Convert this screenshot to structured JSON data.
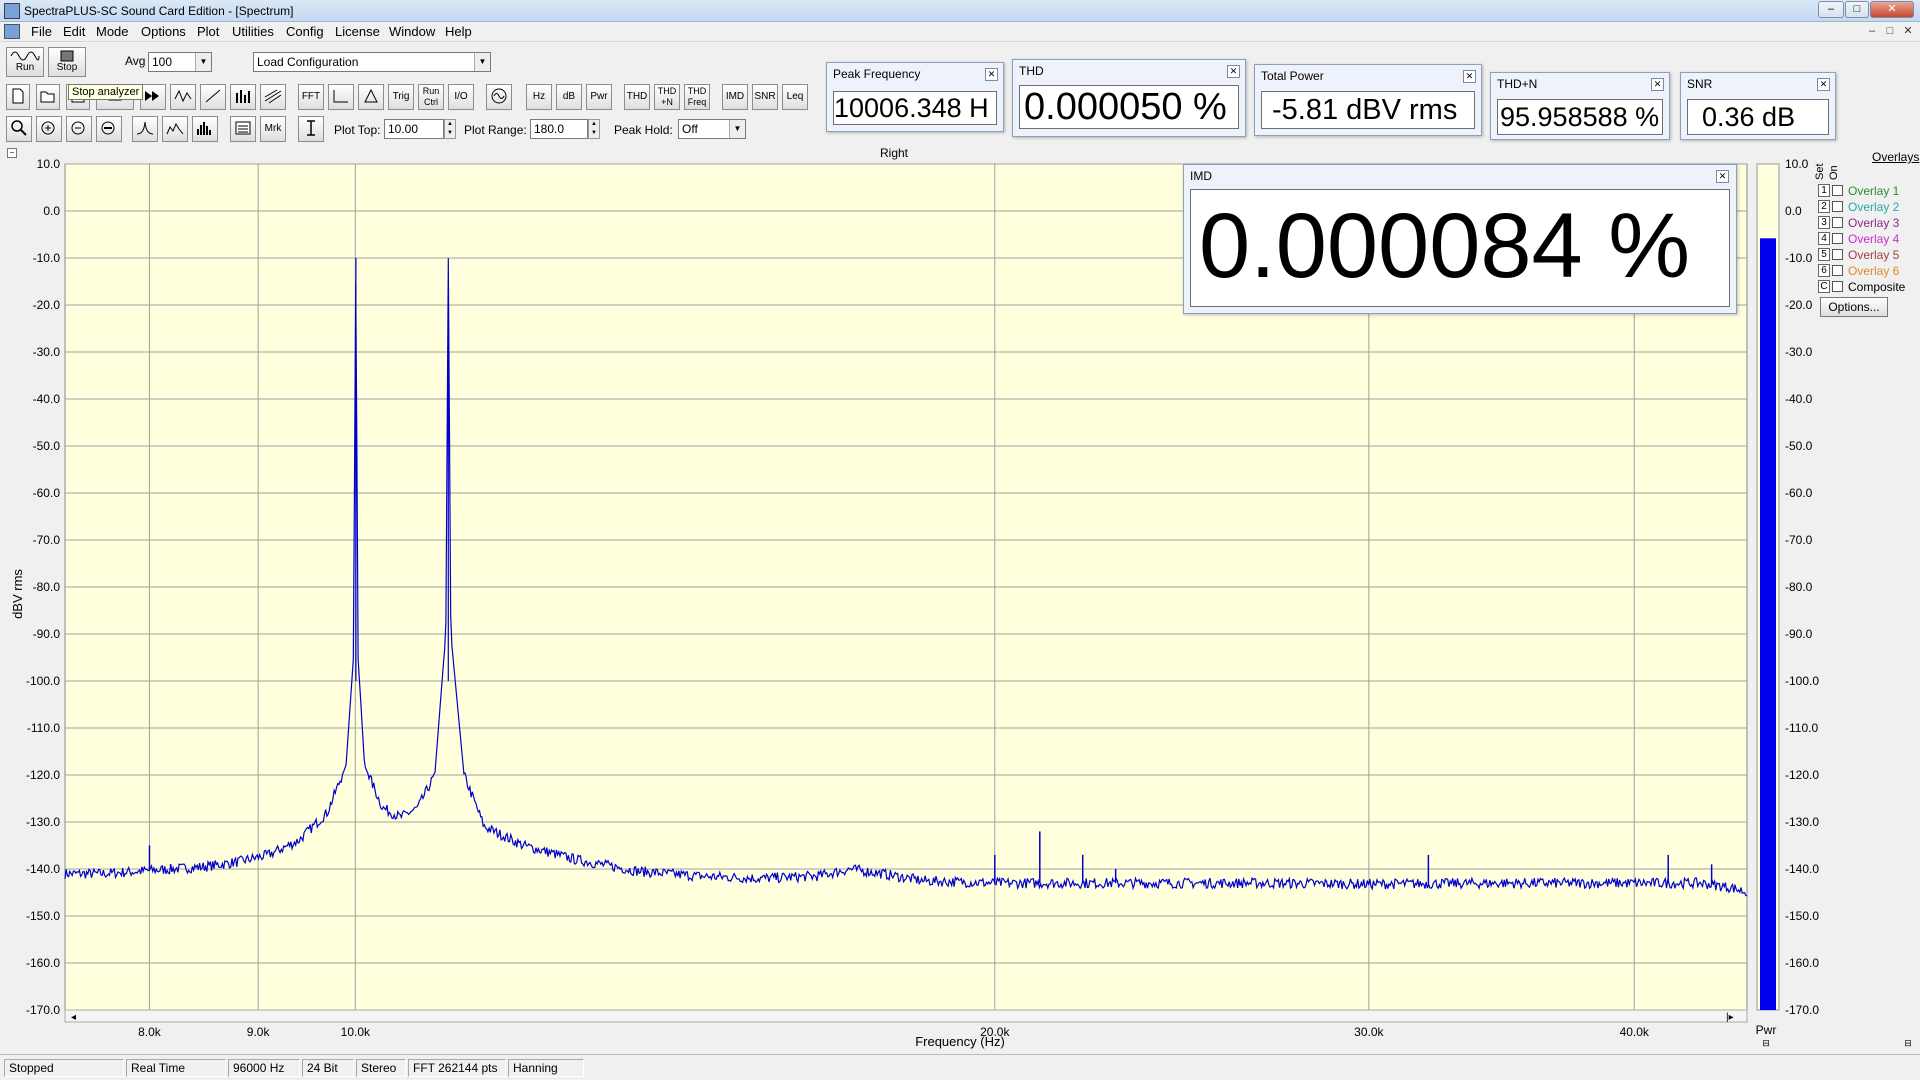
{
  "window": {
    "title": "SpectraPLUS-SC Sound Card Edition - [Spectrum]",
    "min": "–",
    "max": "□",
    "close": "✕"
  },
  "menu": [
    "File",
    "Edit",
    "Mode",
    "Options",
    "Plot",
    "Utilities",
    "Config",
    "License",
    "Window",
    "Help"
  ],
  "toolbar": {
    "run_label": "Run",
    "stop_label": "Stop",
    "avg_label": "Avg",
    "avg_value": "100",
    "load_config": "Load Configuration",
    "tooltip": "Stop analyzer",
    "fft": "FFT",
    "trig": "Trig",
    "run_ctrl": "Run Ctrl",
    "io": "I/O",
    "hz": "Hz",
    "db": "dB",
    "pwr": "Pwr",
    "thd": "THD",
    "thdn": "THD +N",
    "thd_freq": "THD Freq",
    "imd": "IMD",
    "snr": "SNR",
    "leq": "Leq",
    "mrk": "Mrk",
    "plot_top_label": "Plot Top:",
    "plot_top_value": "10.00",
    "plot_range_label": "Plot Range:",
    "plot_range_value": "180.0",
    "peak_hold_label": "Peak Hold:",
    "peak_hold_value": "Off"
  },
  "meters": {
    "peak_frequency": {
      "title": "Peak Frequency",
      "value": "10006.348 H"
    },
    "thd": {
      "title": "THD",
      "value": "0.000050  %"
    },
    "total_power": {
      "title": "Total Power",
      "value": "-5.81 dBV rms"
    },
    "thdn": {
      "title": "THD+N",
      "value": "95.958588 %"
    },
    "snr": {
      "title": "SNR",
      "value": "0.36 dB"
    },
    "imd": {
      "title": "IMD",
      "value": "0.000084  %"
    }
  },
  "chart_data": {
    "type": "line",
    "title": "Right",
    "xlabel": "Frequency (Hz)",
    "ylabel": "dBV rms",
    "xlim": [
      7300,
      45200
    ],
    "ylim": [
      -170,
      10
    ],
    "x_scale": "log",
    "y_ticks": [
      "10.0",
      "0.0",
      "-10.0",
      "-20.0",
      "-30.0",
      "-40.0",
      "-50.0",
      "-60.0",
      "-70.0",
      "-80.0",
      "-90.0",
      "-100.0",
      "-110.0",
      "-120.0",
      "-130.0",
      "-140.0",
      "-150.0",
      "-160.0",
      "-170.0"
    ],
    "x_ticks": [
      {
        "value": 8000,
        "label": "8.0k"
      },
      {
        "value": 9000,
        "label": "9.0k"
      },
      {
        "value": 10000,
        "label": "10.0k"
      },
      {
        "value": 20000,
        "label": "20.0k"
      },
      {
        "value": 30000,
        "label": "30.0k"
      },
      {
        "value": 40000,
        "label": "40.0k"
      }
    ],
    "grid": true,
    "series": [
      {
        "color": "#0000cc",
        "points": [
          [
            7300,
            -141
          ],
          [
            7600,
            -141
          ],
          [
            7900,
            -140.5
          ],
          [
            8200,
            -140
          ],
          [
            8500,
            -139.5
          ],
          [
            8800,
            -138.5
          ],
          [
            9100,
            -137
          ],
          [
            9400,
            -134
          ],
          [
            9700,
            -128
          ],
          [
            9900,
            -118
          ],
          [
            9980,
            -95
          ],
          [
            10006,
            -10
          ],
          [
            10030,
            -95
          ],
          [
            10100,
            -118
          ],
          [
            10300,
            -127
          ],
          [
            10500,
            -129
          ],
          [
            10700,
            -127
          ],
          [
            10900,
            -120
          ],
          [
            11030,
            -90
          ],
          [
            11060,
            -10
          ],
          [
            11090,
            -90
          ],
          [
            11250,
            -120
          ],
          [
            11500,
            -131
          ],
          [
            12000,
            -135
          ],
          [
            12700,
            -138
          ],
          [
            13600,
            -140.5
          ],
          [
            14500,
            -141.5
          ],
          [
            15500,
            -142
          ],
          [
            16500,
            -141.5
          ],
          [
            17100,
            -140
          ],
          [
            17700,
            -141
          ],
          [
            18500,
            -142.5
          ],
          [
            20000,
            -143
          ],
          [
            23000,
            -143
          ],
          [
            27000,
            -143
          ],
          [
            30000,
            -143.2
          ],
          [
            35000,
            -143
          ],
          [
            40000,
            -143
          ],
          [
            43000,
            -143
          ],
          [
            44500,
            -144
          ],
          [
            45200,
            -145
          ]
        ],
        "spikes": [
          [
            8000,
            -135
          ],
          [
            20000,
            -137
          ],
          [
            21000,
            -132
          ],
          [
            22000,
            -137
          ],
          [
            22800,
            -140
          ],
          [
            32000,
            -137
          ],
          [
            41500,
            -137
          ],
          [
            43500,
            -139
          ]
        ]
      }
    ],
    "power_bar": {
      "label": "Pwr",
      "value": -5.81,
      "ticks": [
        "10.0",
        "0.0",
        "-10.0",
        "-20.0",
        "-30.0",
        "-40.0",
        "-50.0",
        "-60.0",
        "-70.0",
        "-80.0",
        "-90.0",
        "-100.0",
        "-110.0",
        "-120.0",
        "-130.0",
        "-140.0",
        "-150.0",
        "-160.0",
        "-170.0"
      ]
    }
  },
  "overlays": {
    "title": "Overlays",
    "col_set": "Set",
    "col_on": "On",
    "items": [
      {
        "num": "1",
        "label": "Overlay 1",
        "color": "#2e8b2e"
      },
      {
        "num": "2",
        "label": "Overlay 2",
        "color": "#2aa8a8"
      },
      {
        "num": "3",
        "label": "Overlay 3",
        "color": "#8a2a8a"
      },
      {
        "num": "4",
        "label": "Overlay 4",
        "color": "#d02ad0"
      },
      {
        "num": "5",
        "label": "Overlay 5",
        "color": "#a04040"
      },
      {
        "num": "6",
        "label": "Overlay 6",
        "color": "#e08a2a"
      },
      {
        "num": "C",
        "label": "Composite",
        "color": "#000000"
      }
    ],
    "options": "Options..."
  },
  "status": [
    "Stopped",
    "Real Time",
    "96000 Hz",
    "24 Bit",
    "Stereo",
    "FFT 262144 pts",
    "Hanning"
  ],
  "colors": {
    "plot_bg": "#ffffdd",
    "trace": "#0000cc",
    "grid": "#a0a0a0"
  }
}
